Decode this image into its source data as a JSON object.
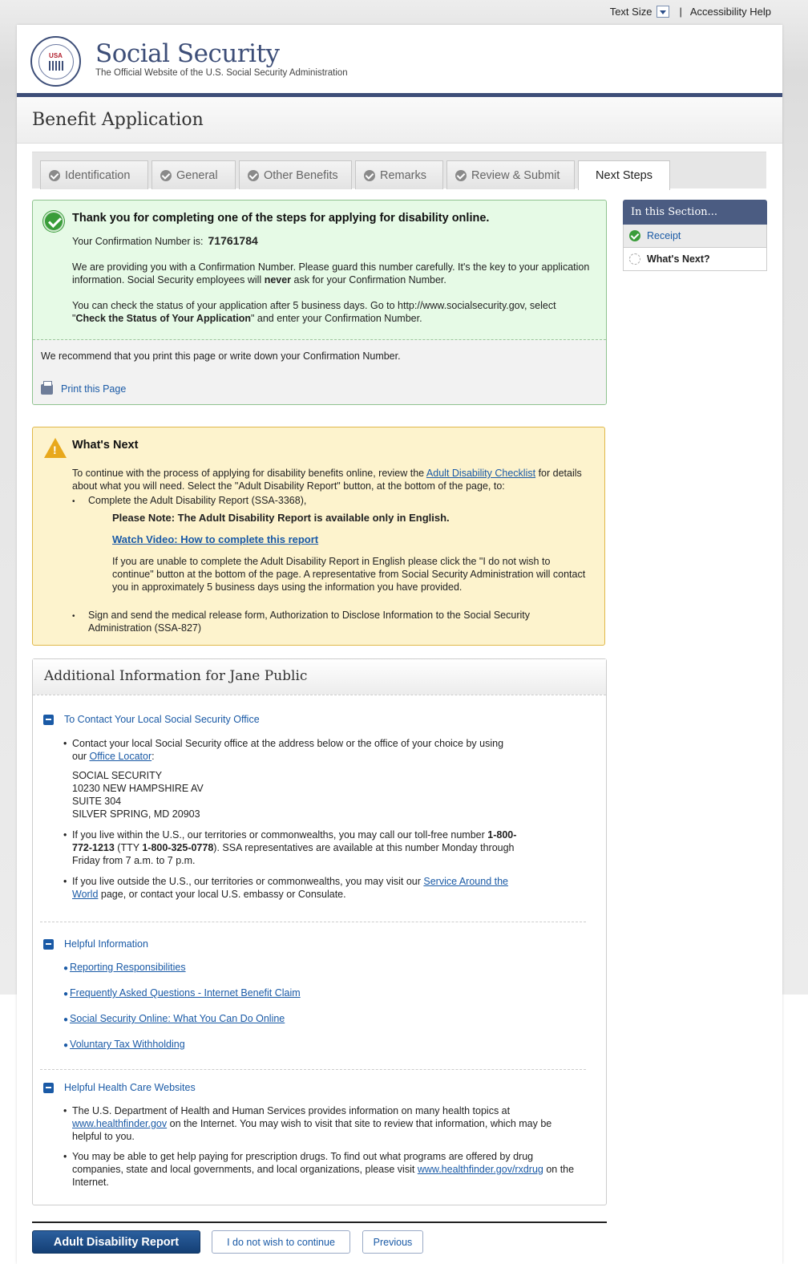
{
  "utility": {
    "text_size": "Text Size",
    "separator": "|",
    "accessibility": "Accessibility Help"
  },
  "masthead": {
    "seal_text": "USA",
    "title": "Social Security",
    "subtitle": "The Official Website of the U.S. Social Security Administration"
  },
  "app": {
    "title": "Benefit Application"
  },
  "tabs": [
    {
      "label": "Identification",
      "done": true
    },
    {
      "label": "General",
      "done": true
    },
    {
      "label": "Other Benefits",
      "done": true
    },
    {
      "label": "Remarks",
      "done": true
    },
    {
      "label": "Review & Submit",
      "done": true
    },
    {
      "label": "Next Steps",
      "active": true
    }
  ],
  "confirmation": {
    "title": "Thank you for completing one of the steps for applying for disability online.",
    "number_label": "Your Confirmation Number is:",
    "number": "71761784",
    "p1_a": "We are providing you with a Confirmation Number. Please guard this number carefully. It's the key to your application information. Social Security employees will ",
    "p1_b": "never",
    "p1_c": " ask for your Confirmation Number.",
    "p2_a": "You can check the status of your application after 5 business days. Go to http://www.socialsecurity.gov, select \"",
    "p2_b": "Check the Status of Your Application",
    "p2_c": "\" and enter your Confirmation Number.",
    "recommend": "We recommend that you print this page or write down your Confirmation Number.",
    "print": "Print this Page"
  },
  "whats_next": {
    "title": "What's Next",
    "intro_a": "To continue with the process of applying for disability benefits online, review the ",
    "intro_link": "Adult Disability Checklist",
    "intro_b": " for details about what you will need. Select the \"Adult Disability Report\" button, at the bottom of the page, to:",
    "item1": "Complete the Adult Disability Report (SSA-3368),",
    "note": "Please Note: The Adult Disability Report is available only in English.",
    "video": "Watch Video: How to complete this report",
    "unable": "If you are unable to complete the Adult Disability Report in English please click the \"I do not wish to continue\" button at the bottom of the page. A representative from Social Security Administration will contact you in approximately 5 business days using the information you have provided.",
    "item2": "Sign and send the medical release form, Authorization to Disclose Information to the Social Security Administration (SSA-827)"
  },
  "info": {
    "title": "Additional Information for Jane Public",
    "contact": {
      "heading": "To Contact Your Local Social Security Office",
      "b1_a": "Contact your local Social Security office at the address below or the office of your choice by using our ",
      "b1_link": "Office Locator",
      "b1_b": ":",
      "addr1": "SOCIAL SECURITY",
      "addr2": "10230 NEW HAMPSHIRE AV",
      "addr3": "SUITE 304",
      "addr4": "SILVER SPRING, MD 20903",
      "b2_a": "If you live within the U.S., our territories or commonwealths, you may call our toll-free number ",
      "b2_phone": "1-800-772-1213",
      "b2_b": " (TTY ",
      "b2_tty": "1-800-325-0778",
      "b2_c": "). SSA representatives are available at this number Monday through Friday from 7 a.m. to 7 p.m.",
      "b3_a": "If you live outside the U.S., our territories or commonwealths, you may visit our ",
      "b3_link": "Service Around the World",
      "b3_b": " page, or contact your local U.S. embassy or Consulate."
    },
    "helpful": {
      "heading": "Helpful Information",
      "links": [
        "Reporting Responsibilities",
        "Frequently Asked Questions - Internet Benefit Claim",
        "Social Security Online: What You Can Do Online",
        "Voluntary Tax Withholding"
      ]
    },
    "health": {
      "heading": "Helpful Health Care Websites",
      "b1_a": "The U.S. Department of Health and Human Services provides information on many health topics at ",
      "b1_link": "www.healthfinder.gov",
      "b1_b": " on the Internet. You may wish to visit that site to review that information, which may be helpful to you.",
      "b2_a": "You may be able to get help paying for prescription drugs. To find out what programs are offered by drug companies, state and local governments, and local organizations, please visit ",
      "b2_link": "www.healthfinder.gov/rxdrug",
      "b2_b": " on the Internet."
    }
  },
  "buttons": {
    "primary": "Adult Disability Report",
    "decline": "I do not wish to continue",
    "previous": "Previous"
  },
  "sidebar": {
    "title": "In this Section...",
    "item1": "Receipt",
    "item2": "What's Next?"
  }
}
